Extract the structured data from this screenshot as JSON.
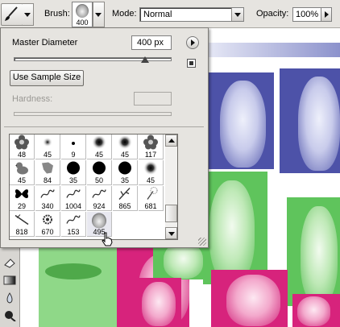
{
  "options_bar": {
    "brush_label": "Brush:",
    "brush_size": "400",
    "mode_label": "Mode:",
    "mode_value": "Normal",
    "opacity_label": "Opacity:",
    "opacity_value": "100%"
  },
  "brush_panel": {
    "master_diameter_label": "Master Diameter",
    "master_diameter_value": "400 px",
    "master_diameter_slider_fraction": 0.84,
    "use_sample_size_label": "Use Sample Size",
    "hardness_label": "Hardness:",
    "hardness_value": "",
    "presets": [
      {
        "size": "48",
        "kind": "flower"
      },
      {
        "size": "45",
        "kind": "soft-small"
      },
      {
        "size": "9",
        "kind": "dot-small"
      },
      {
        "size": "45",
        "kind": "soft"
      },
      {
        "size": "45",
        "kind": "soft"
      },
      {
        "size": "117",
        "kind": "flower"
      },
      {
        "size": "45",
        "kind": "duck"
      },
      {
        "size": "84",
        "kind": "map"
      },
      {
        "size": "35",
        "kind": "hard"
      },
      {
        "size": "50",
        "kind": "hard"
      },
      {
        "size": "35",
        "kind": "hard"
      },
      {
        "size": "45",
        "kind": "soft"
      },
      {
        "size": "29",
        "kind": "butterfly"
      },
      {
        "size": "340",
        "kind": "scribble"
      },
      {
        "size": "1004",
        "kind": "scribble"
      },
      {
        "size": "924",
        "kind": "scribble"
      },
      {
        "size": "865",
        "kind": "branch"
      },
      {
        "size": "681",
        "kind": "dandelion"
      },
      {
        "size": "818",
        "kind": "stroke"
      },
      {
        "size": "670",
        "kind": "splat"
      },
      {
        "size": "153",
        "kind": "scribble"
      },
      {
        "size": "495",
        "kind": "portrait"
      }
    ]
  },
  "colors": {
    "blue_tile": "#4d52a8",
    "green_tile": "#5fc45c",
    "pink_tile": "#d7237c"
  }
}
